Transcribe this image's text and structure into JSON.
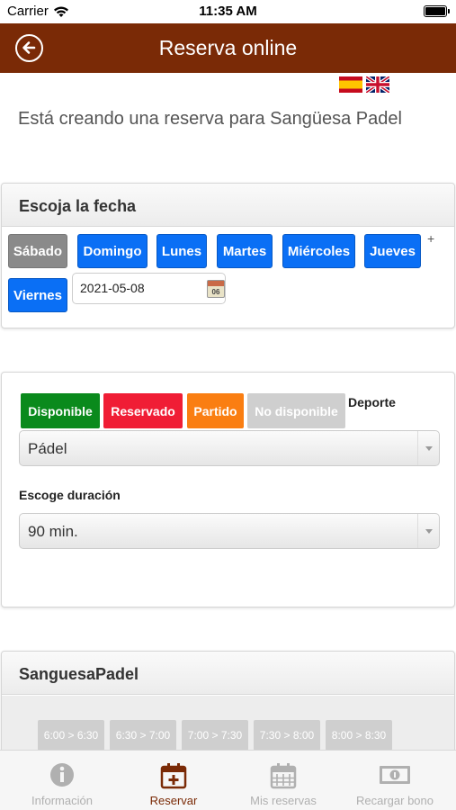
{
  "status_bar": {
    "carrier": "Carrier",
    "time": "11:35 AM"
  },
  "header": {
    "title": "Reserva online"
  },
  "intro_text": "Está creando una reserva para Sangüesa Padel",
  "date_section": {
    "title": "Escoja la fecha",
    "days": [
      "Sábado",
      "Domingo",
      "Lunes",
      "Martes",
      "Miércoles",
      "Jueves",
      "Viernes"
    ],
    "selected_day": "Sábado",
    "more_mark": "+",
    "date_value": "2021-05-08",
    "calendar_icon_day": "06"
  },
  "sport_section": {
    "legend": [
      {
        "label": "Disponible",
        "color": "#0a8a1c"
      },
      {
        "label": "Reservado",
        "color": "#f01d35"
      },
      {
        "label": "Partido",
        "color": "#fa7e12"
      },
      {
        "label": "No disponible",
        "color": "#cfcfcf"
      }
    ],
    "sport_label": "Deporte",
    "sport_value": "Pádel",
    "duration_label": "Escoge duración",
    "duration_value": "90 min."
  },
  "club_section": {
    "title": "SanguesaPadel",
    "slots": [
      "6:00 > 6:30",
      "6:30 > 7:00",
      "7:00 > 7:30",
      "7:30 > 8:00",
      "8:00 > 8:30"
    ]
  },
  "tabs": [
    {
      "label": "Información",
      "icon": "info-icon"
    },
    {
      "label": "Reservar",
      "icon": "calendar-add-icon",
      "active": true
    },
    {
      "label": "Mis reservas",
      "icon": "calendar-grid-icon"
    },
    {
      "label": "Recargar bono",
      "icon": "money-icon"
    }
  ],
  "colors": {
    "header": "#7a2a06",
    "day_button": "#0a6ff5",
    "selected_day": "#8a8a8a"
  }
}
